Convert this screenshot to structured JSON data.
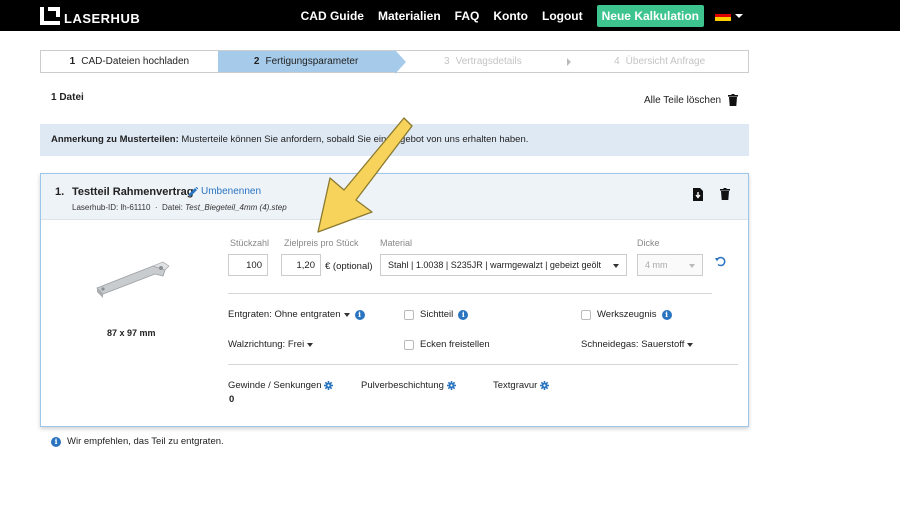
{
  "brand": {
    "logo_text": "LASERHUB"
  },
  "nav": {
    "items": [
      "CAD Guide",
      "Materialien",
      "FAQ",
      "Konto",
      "Logout"
    ],
    "cta": "Neue Kalkulation",
    "language_flag": "de-flag-icon"
  },
  "steps": [
    {
      "num": "1",
      "label": "CAD-Dateien hochladen",
      "state": "done"
    },
    {
      "num": "2",
      "label": "Fertigungsparameter",
      "state": "active"
    },
    {
      "num": "3",
      "label": "Vertragsdetails",
      "state": "disabled"
    },
    {
      "num": "4",
      "label": "Übersicht Anfrage",
      "state": "disabled"
    }
  ],
  "files": {
    "count_label": "1 Datei",
    "delete_all": "Alle Teile löschen"
  },
  "notice": {
    "bold": "Anmerkung zu Musterteilen:",
    "text": "Musterteile können Sie anfordern, sobald Sie ein Angebot von uns erhalten haben."
  },
  "part": {
    "number": "1.",
    "title": "Testteil Rahmenvertrag",
    "rename": "Umbenennen",
    "meta_id": "Laserhub-ID: lh-61110",
    "meta_sep": "·",
    "meta_file_label": "Datei:",
    "meta_file": "Test_Biegeteil_4mm (4).step",
    "dimensions": "87 x 97 mm",
    "fields": {
      "qty_label": "Stückzahl",
      "qty_value": "100",
      "price_label": "Zielpreis pro Stück",
      "price_value": "1,20",
      "price_suffix": "€ (optional)",
      "material_label": "Material",
      "material_value": "Stahl | 1.0038 | S235JR | warmgewalzt | gebeizt geölt",
      "thickness_label": "Dicke",
      "thickness_value": "4 mm"
    },
    "options": {
      "deburr": "Entgraten: Ohne entgraten",
      "visible": "Sichtteil",
      "certificate": "Werkszeugnis",
      "rolling": "Walzrichtung: Frei",
      "corners": "Ecken freistellen",
      "gas": "Schneidegas: Sauerstoff"
    },
    "extras": {
      "threads_label": "Gewinde / Senkungen",
      "threads_value": "0",
      "powder_label": "Pulverbeschichtung",
      "engraving_label": "Textgravur"
    }
  },
  "footer_hint": "Wir empfehlen, das Teil zu entgraten.",
  "colors": {
    "accent_blue": "#2a74c0",
    "cta_green": "#3ec48e",
    "step_active": "#a6cbea",
    "arrow_yellow": "#f7d35c"
  }
}
